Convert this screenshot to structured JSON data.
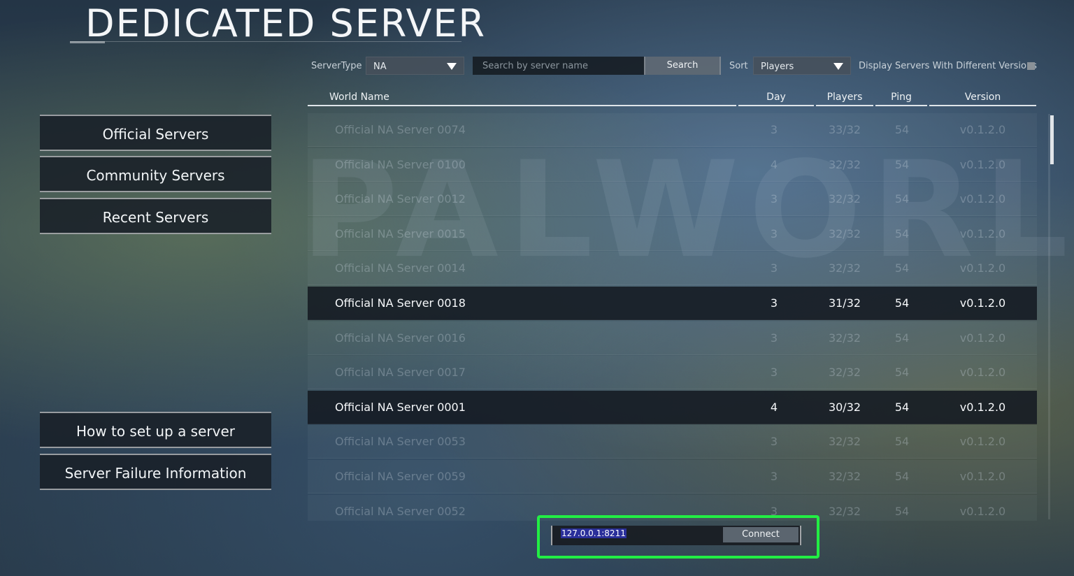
{
  "header": {
    "title": "DEDICATED SERVER"
  },
  "filters": {
    "server_type_label": "ServerType",
    "server_type_value": "NA",
    "search_placeholder": "Search by server name",
    "search_button": "Search",
    "sort_label": "Sort",
    "sort_value": "Players",
    "different_versions_label": "Display Servers With Different Versions",
    "different_versions_checked": false
  },
  "table": {
    "columns": [
      "World Name",
      "Day",
      "Players",
      "Ping",
      "Version"
    ],
    "rows": [
      {
        "name": "Official NA Server 0074",
        "day": "3",
        "players": "33/32",
        "ping": "54",
        "version": "v0.1.2.0",
        "highlighted": false
      },
      {
        "name": "Official NA Server 0100",
        "day": "4",
        "players": "32/32",
        "ping": "54",
        "version": "v0.1.2.0",
        "highlighted": false
      },
      {
        "name": "Official NA Server 0012",
        "day": "3",
        "players": "32/32",
        "ping": "54",
        "version": "v0.1.2.0",
        "highlighted": false
      },
      {
        "name": "Official NA Server 0015",
        "day": "3",
        "players": "32/32",
        "ping": "54",
        "version": "v0.1.2.0",
        "highlighted": false
      },
      {
        "name": "Official NA Server 0014",
        "day": "3",
        "players": "32/32",
        "ping": "54",
        "version": "v0.1.2.0",
        "highlighted": false
      },
      {
        "name": "Official NA Server 0018",
        "day": "3",
        "players": "31/32",
        "ping": "54",
        "version": "v0.1.2.0",
        "highlighted": true
      },
      {
        "name": "Official NA Server 0016",
        "day": "3",
        "players": "32/32",
        "ping": "54",
        "version": "v0.1.2.0",
        "highlighted": false
      },
      {
        "name": "Official NA Server 0017",
        "day": "3",
        "players": "32/32",
        "ping": "54",
        "version": "v0.1.2.0",
        "highlighted": false
      },
      {
        "name": "Official NA Server 0001",
        "day": "4",
        "players": "30/32",
        "ping": "54",
        "version": "v0.1.2.0",
        "highlighted": true
      },
      {
        "name": "Official NA Server 0053",
        "day": "3",
        "players": "32/32",
        "ping": "54",
        "version": "v0.1.2.0",
        "highlighted": false
      },
      {
        "name": "Official NA Server 0059",
        "day": "3",
        "players": "32/32",
        "ping": "54",
        "version": "v0.1.2.0",
        "highlighted": false
      },
      {
        "name": "Official NA Server 0052",
        "day": "3",
        "players": "32/32",
        "ping": "54",
        "version": "v0.1.2.0",
        "highlighted": false
      }
    ]
  },
  "sidebar": {
    "top_buttons": [
      "Official Servers",
      "Community Servers",
      "Recent Servers"
    ],
    "bottom_buttons": [
      "How to set up a server",
      "Server Failure Information"
    ]
  },
  "connect": {
    "ip_value": "127.0.0.1:8211",
    "button_label": "Connect"
  },
  "colors": {
    "highlight_border": "#22ee44",
    "selection": "#2a2f9a"
  }
}
